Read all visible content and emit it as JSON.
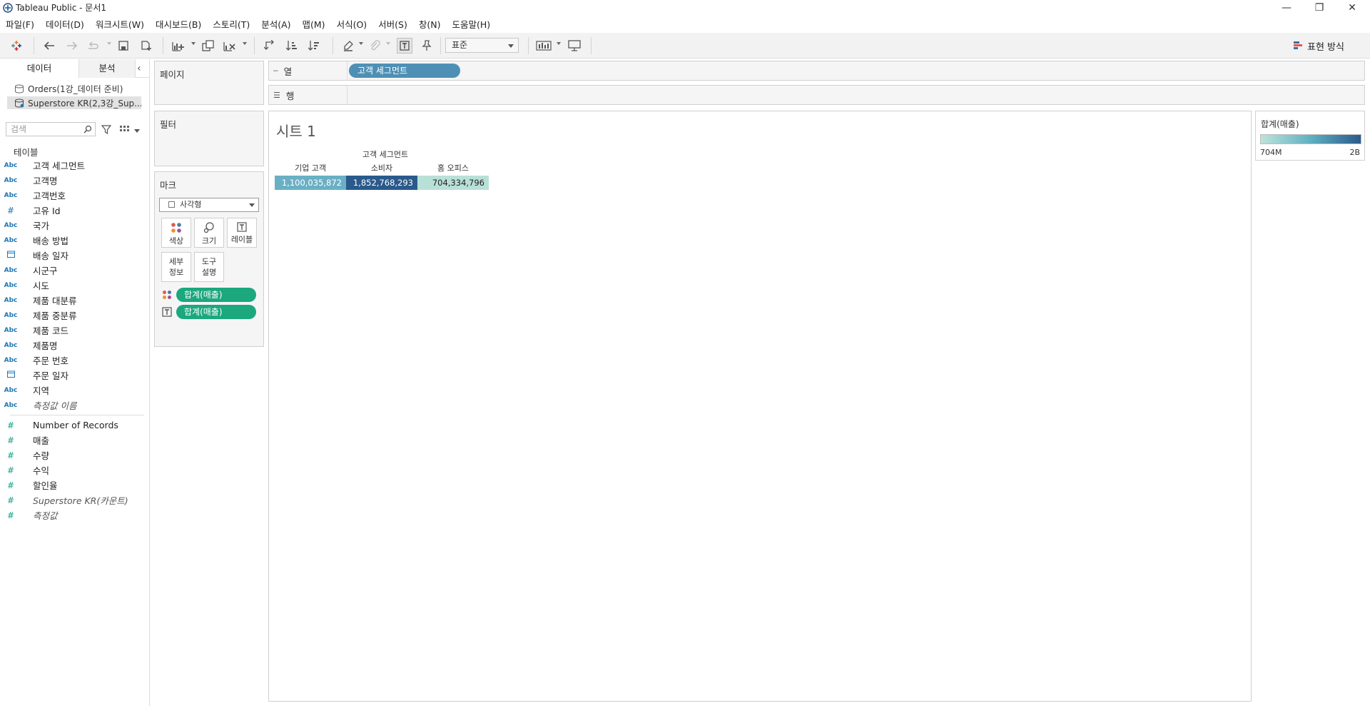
{
  "window": {
    "title": "Tableau Public - 문서1"
  },
  "menu": [
    "파일(F)",
    "데이터(D)",
    "워크시트(W)",
    "대시보드(B)",
    "스토리(T)",
    "분석(A)",
    "맵(M)",
    "서식(O)",
    "서버(S)",
    "창(N)",
    "도움말(H)"
  ],
  "toolbar": {
    "fit_value": "표준",
    "show_me_label": "표현 방식"
  },
  "left_pane": {
    "tab_data": "데이터",
    "tab_analysis": "분석",
    "datasources": [
      "Orders(1강_데이터 준비)",
      "Superstore KR(2,3강_Sup..."
    ],
    "search_placeholder": "검색",
    "tables_heading": "테이블",
    "dimensions": [
      {
        "type": "Abc",
        "name": "고객 세그먼트"
      },
      {
        "type": "Abc",
        "name": "고객명"
      },
      {
        "type": "Abc",
        "name": "고객번호"
      },
      {
        "type": "#",
        "name": "고유 Id"
      },
      {
        "type": "Abc",
        "name": "국가"
      },
      {
        "type": "Abc",
        "name": "배송 방법"
      },
      {
        "type": "date",
        "name": "배송 일자"
      },
      {
        "type": "Abc",
        "name": "시군구"
      },
      {
        "type": "Abc",
        "name": "시도"
      },
      {
        "type": "Abc",
        "name": "제품 대분류"
      },
      {
        "type": "Abc",
        "name": "제품 중분류"
      },
      {
        "type": "Abc",
        "name": "제품 코드"
      },
      {
        "type": "Abc",
        "name": "제품명"
      },
      {
        "type": "Abc",
        "name": "주문 번호"
      },
      {
        "type": "date",
        "name": "주문 일자"
      },
      {
        "type": "Abc",
        "name": "지역"
      },
      {
        "type": "Abc",
        "name": "측정값 이름",
        "italic": true
      }
    ],
    "measures": [
      {
        "name": "Number of Records"
      },
      {
        "name": "매출"
      },
      {
        "name": "수량"
      },
      {
        "name": "수익"
      },
      {
        "name": "할인율"
      },
      {
        "name": "Superstore KR(카운트)",
        "italic": true
      },
      {
        "name": "측정값",
        "italic": true
      }
    ]
  },
  "shelves": {
    "pages_title": "페이지",
    "filters_title": "필터",
    "marks_title": "마크",
    "mark_type": "사각형",
    "mark_buttons": {
      "color": "색상",
      "size": "크기",
      "label": "레이블",
      "detail": "세부\n정보",
      "tooltip": "도구\n설명"
    },
    "mark_pills": [
      "합계(매출)",
      "합계(매출)"
    ],
    "columns_label": "열",
    "rows_label": "행",
    "columns_pill": "고객 세그먼트"
  },
  "viz": {
    "sheet_title": "시트 1",
    "header_title": "고객 세그먼트",
    "columns": [
      {
        "name": "기업 고객",
        "value": "1,100,035,872",
        "color": "#6ab0c4"
      },
      {
        "name": "소비자",
        "value": "1,852,768,293",
        "color": "#2a5a8c"
      },
      {
        "name": "홈 오피스",
        "value": "704,334,796",
        "color": "#b9e0d6"
      }
    ]
  },
  "legend": {
    "title": "합계(매출)",
    "min": "704M",
    "max": "2B"
  }
}
